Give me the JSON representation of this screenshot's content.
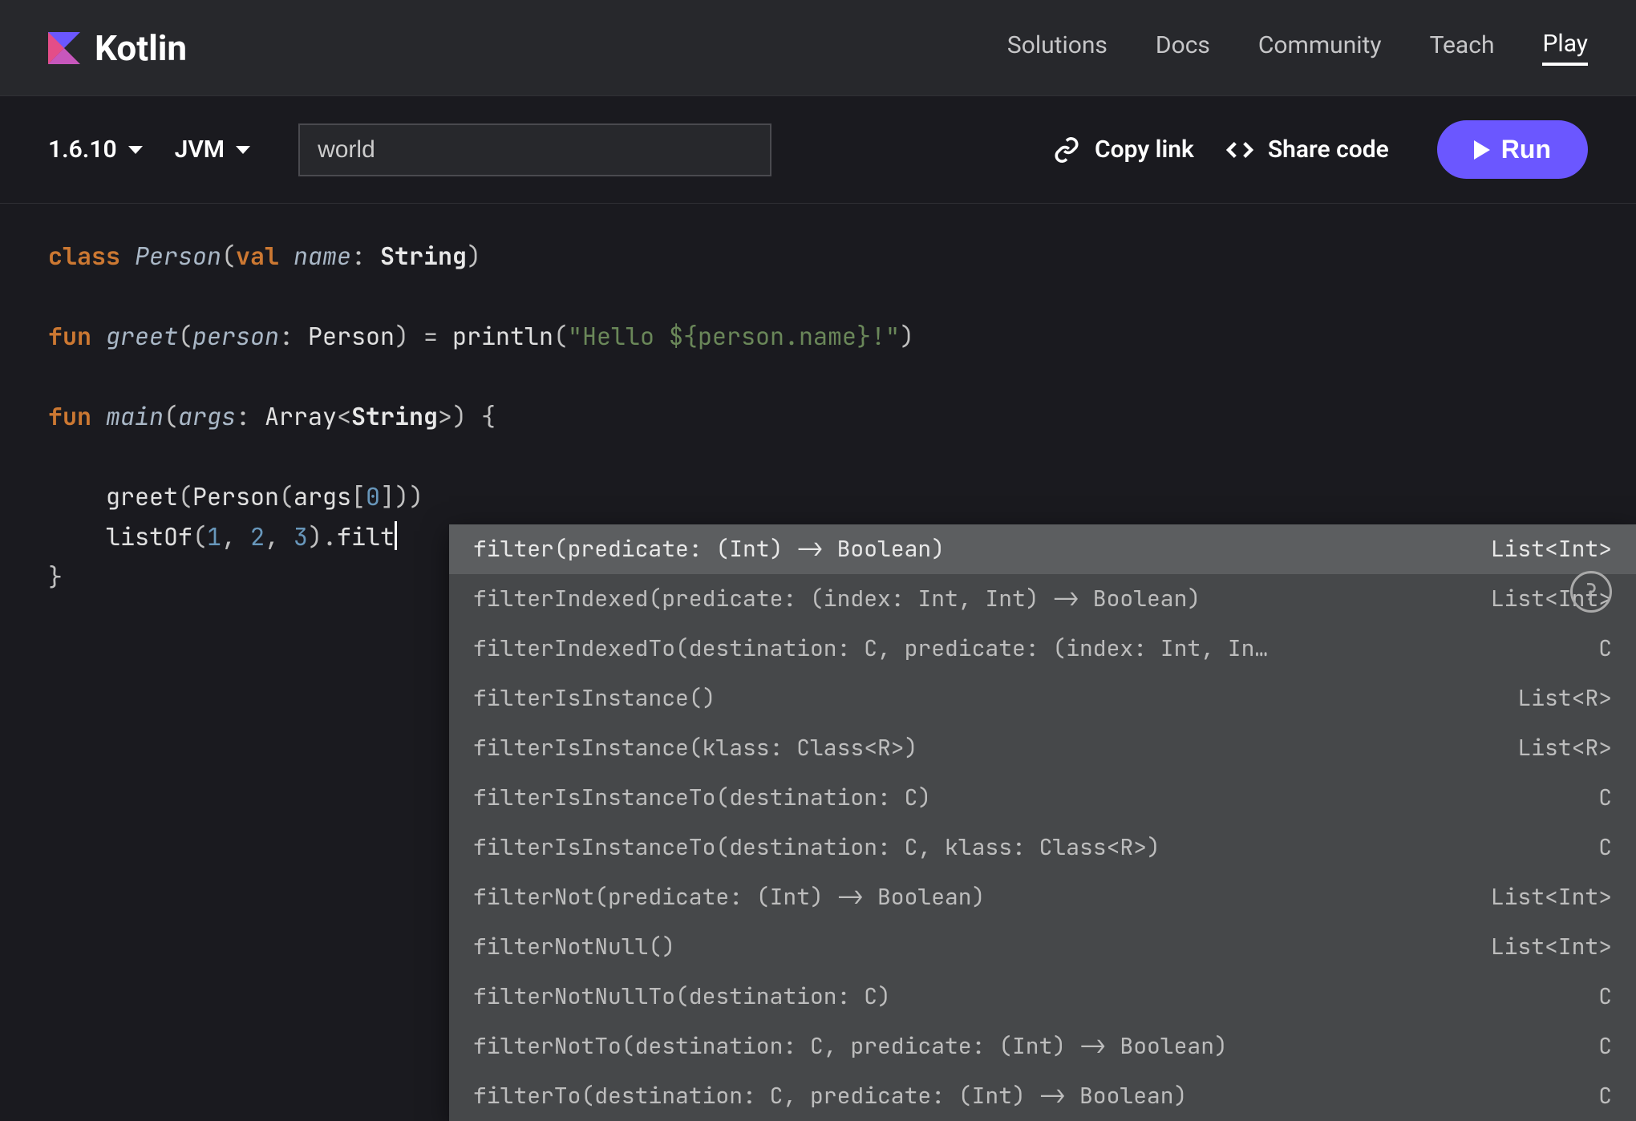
{
  "header": {
    "brand": "Kotlin",
    "nav": [
      {
        "label": "Solutions",
        "active": false
      },
      {
        "label": "Docs",
        "active": false
      },
      {
        "label": "Community",
        "active": false
      },
      {
        "label": "Teach",
        "active": false
      },
      {
        "label": "Play",
        "active": true
      }
    ]
  },
  "toolbar": {
    "version": "1.6.10",
    "target": "JVM",
    "args_value": "world",
    "copy_link_label": "Copy link",
    "share_code_label": "Share code",
    "run_label": "Run"
  },
  "code": {
    "line1": {
      "kw1": "class",
      "name": "Person",
      "kw2": "val",
      "param": "name",
      "type": "String"
    },
    "line3": {
      "kw": "fun",
      "name": "greet",
      "param": "person",
      "ptype": "Person",
      "call": "println",
      "str": "\"Hello ${person.name}!\""
    },
    "line4": {
      "kw": "fun",
      "name": "main",
      "param": "args",
      "ptype1": "Array",
      "ptype2": "String"
    },
    "line6": {
      "call1": "greet",
      "call2": "Person",
      "arr": "args",
      "idx": "0"
    },
    "line7": {
      "call": "listOf",
      "n1": "1",
      "n2": "2",
      "n3": "3",
      "partial": "filt"
    }
  },
  "autocomplete": {
    "selected_index": 0,
    "items": [
      {
        "sig": "filter(predicate: (Int) -> Boolean)",
        "ret": "List<Int>"
      },
      {
        "sig": "filterIndexed(predicate: (index: Int, Int) -> Boolean)",
        "ret": "List<Int>"
      },
      {
        "sig": "filterIndexedTo(destination: C, predicate: (index: Int, In…",
        "ret": "C"
      },
      {
        "sig": "filterIsInstance()",
        "ret": "List<R>"
      },
      {
        "sig": "filterIsInstance(klass: Class<R>)",
        "ret": "List<R>"
      },
      {
        "sig": "filterIsInstanceTo(destination: C)",
        "ret": "C"
      },
      {
        "sig": "filterIsInstanceTo(destination: C, klass: Class<R>)",
        "ret": "C"
      },
      {
        "sig": "filterNot(predicate: (Int) -> Boolean)",
        "ret": "List<Int>"
      },
      {
        "sig": "filterNotNull()",
        "ret": "List<Int>"
      },
      {
        "sig": "filterNotNullTo(destination: C)",
        "ret": "C"
      },
      {
        "sig": "filterNotTo(destination: C, predicate: (Int) -> Boolean)",
        "ret": "C"
      },
      {
        "sig": "filterTo(destination: C, predicate: (Int) -> Boolean)",
        "ret": "C"
      }
    ]
  },
  "help_label": "?"
}
